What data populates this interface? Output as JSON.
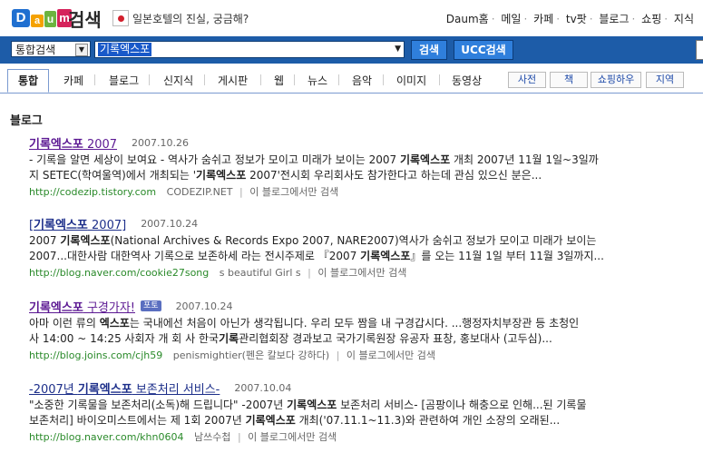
{
  "header": {
    "logo": {
      "d": "D",
      "a": "a",
      "u": "u",
      "m": "m"
    },
    "logo_word": "검색",
    "promo_text": "일본호텔의 진실, 궁금해?",
    "gnb": [
      "Daum홈",
      "메일",
      "카페",
      "tv팟",
      "블로그",
      "쇼핑",
      "지식"
    ]
  },
  "search": {
    "scope": "통합검색",
    "query": "기록엑스포",
    "search_button": "검색",
    "ucc_button": "UCC검색"
  },
  "tabs": {
    "items": [
      "통합",
      "카페",
      "블로그",
      "신지식",
      "게시판",
      "웹",
      "뉴스",
      "음악",
      "이미지",
      "동영상"
    ],
    "pills": [
      "사전",
      "책",
      "쇼핑하우",
      "지역"
    ]
  },
  "section_title": "블로그",
  "results": [
    {
      "title_pre": "",
      "title_bold": "기록엑스포",
      "title_post": " 2007",
      "date": "2007.10.26",
      "badge": "",
      "line1": [
        "- 기록을 알면 세상이 보여요 - 역사가 숨쉬고 정보가 모이고 미래가 보이는 2007 ",
        "기록엑스포",
        " 개최 2007년 11월 1일~3일까"
      ],
      "line2": [
        "지 SETEC(학여울역)에서 개최되는 '",
        "기록엑스포",
        " 2007'전시회 우리회사도 참가한다고 하는데 관심 있으신 분은..."
      ],
      "url": "http://codezip.tistory.com",
      "blog": "CODEZIP.NET",
      "only": "이 블로그에서만 검색"
    },
    {
      "title_pre": "[",
      "title_bold": "기록엑스포",
      "title_post": " 2007]",
      "date": "2007.10.24",
      "badge": "",
      "line1": [
        "2007 ",
        "기록엑스포",
        "(National Archives & Records Expo 2007, NARE2007)역사가 숨쉬고 정보가 모이고 미래가 보이는"
      ],
      "line2": [
        "2007...대한사람 대한역사 기록으로 보존하세 라는 전시주제로 『2007 ",
        "기록엑스포",
        "』를 오는 11월 1일 부터 11월 3일까지..."
      ],
      "url": "http://blog.naver.com/cookie27song",
      "blog": "s beautiful Girl s",
      "only": "이 블로그에서만 검색"
    },
    {
      "title_pre": "",
      "title_bold": "기록엑스포",
      "title_post": " 구경가자!",
      "date": "2007.10.24",
      "badge": "포토",
      "line1": [
        "아마 이런 류의 ",
        "엑스포",
        "는 국내에선 처음이 아닌가 생각됩니다. 우리 모두 짬을 내 구경갑시다. ...행정자치부장관 등 초청인"
      ],
      "line2": [
        "사 14:00 ~ 14:25 사회자 개 회 사 한국",
        "기록",
        "관리협회장 경과보고 국가기록원장 유공자 표창, 홍보대사 (고두심)..."
      ],
      "url": "http://blog.joins.com/cjh59",
      "blog": "penismightier(펜은 칼보다 강하다)",
      "only": "이 블로그에서만 검색"
    },
    {
      "title_pre": "-2007년 ",
      "title_bold": "기록엑스포",
      "title_post": " 보존처리 서비스-",
      "date": "2007.10.04",
      "badge": "",
      "line1": [
        "\"소중한 기록물을 보존처리(소독)해 드립니다\" -2007년 ",
        "기록엑스포",
        " 보존처리 서비스- [곰팡이나 해충으로 인해...된 기록물"
      ],
      "line2": [
        "보존처리] 바이오미스트에서는 제 1회 2007년 ",
        "기록엑스포",
        " 개최('07.11.1~11.3)와 관련하여 개인 소장의 오래된..."
      ],
      "url": "http://blog.naver.com/khn0604",
      "blog": "남쓰수첩",
      "only": "이 블로그에서만 검색"
    }
  ]
}
